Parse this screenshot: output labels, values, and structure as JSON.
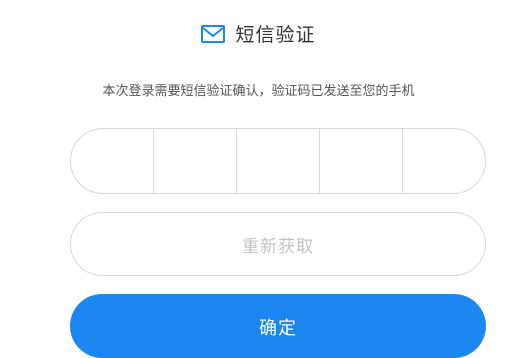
{
  "header": {
    "icon": "mail-icon",
    "title": "短信验证"
  },
  "subtitle": "本次登录需要短信验证确认，验证码已发送至您的手机",
  "code_input": {
    "cells": [
      "",
      "",
      "",
      "",
      ""
    ]
  },
  "resend_label": "重新获取",
  "confirm_label": "确定",
  "colors": {
    "accent": "#1c86f2",
    "border": "#d9d9d9",
    "disabled_text": "#c2c2c2"
  }
}
